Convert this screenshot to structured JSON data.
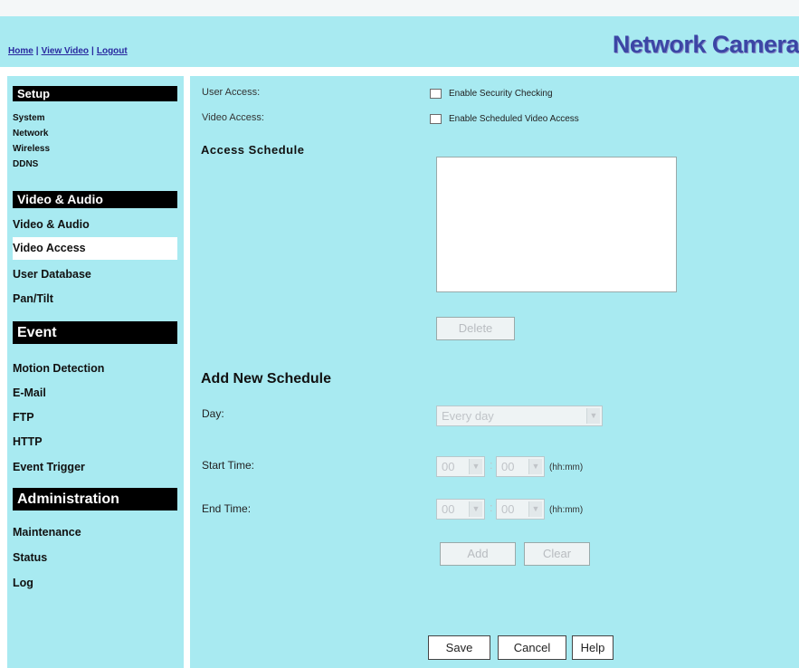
{
  "header": {
    "nav": [
      "Home",
      "View Video",
      "Logout"
    ],
    "brand": "Network Camera"
  },
  "sidebar": {
    "sections": [
      {
        "title": "Setup",
        "items": [
          "System",
          "Network",
          "Wireless",
          "DDNS"
        ]
      },
      {
        "title": "Video & Audio",
        "items": [
          "Video & Audio",
          "Video Access",
          "User Database",
          "Pan/Tilt"
        ]
      },
      {
        "title": "Event",
        "items": [
          "Motion Detection",
          "E-Mail",
          "FTP",
          "HTTP",
          "Event Trigger"
        ]
      },
      {
        "title": "Administration",
        "items": [
          "Maintenance",
          "Status",
          "Log"
        ]
      }
    ],
    "active_item": "Video Access"
  },
  "main": {
    "user_access_label": "User Access:",
    "video_access_label": "Video Access:",
    "enable_security_label": "Enable Security Checking",
    "enable_schedule_label": "Enable Scheduled Video Access",
    "access_schedule_heading": "Access Schedule",
    "delete_button": "Delete",
    "add_schedule_heading": "Add New Schedule",
    "day_label": "Day:",
    "day_value": "Every day",
    "start_time_label": "Start Time:",
    "end_time_label": "End Time:",
    "start_hour": "00",
    "start_minute": "00",
    "end_hour": "00",
    "end_minute": "00",
    "time_colon": ":",
    "time_format": "(hh:mm)",
    "add_button": "Add",
    "clear_button": "Clear",
    "save_button": "Save",
    "cancel_button": "Cancel",
    "help_button": "Help"
  }
}
